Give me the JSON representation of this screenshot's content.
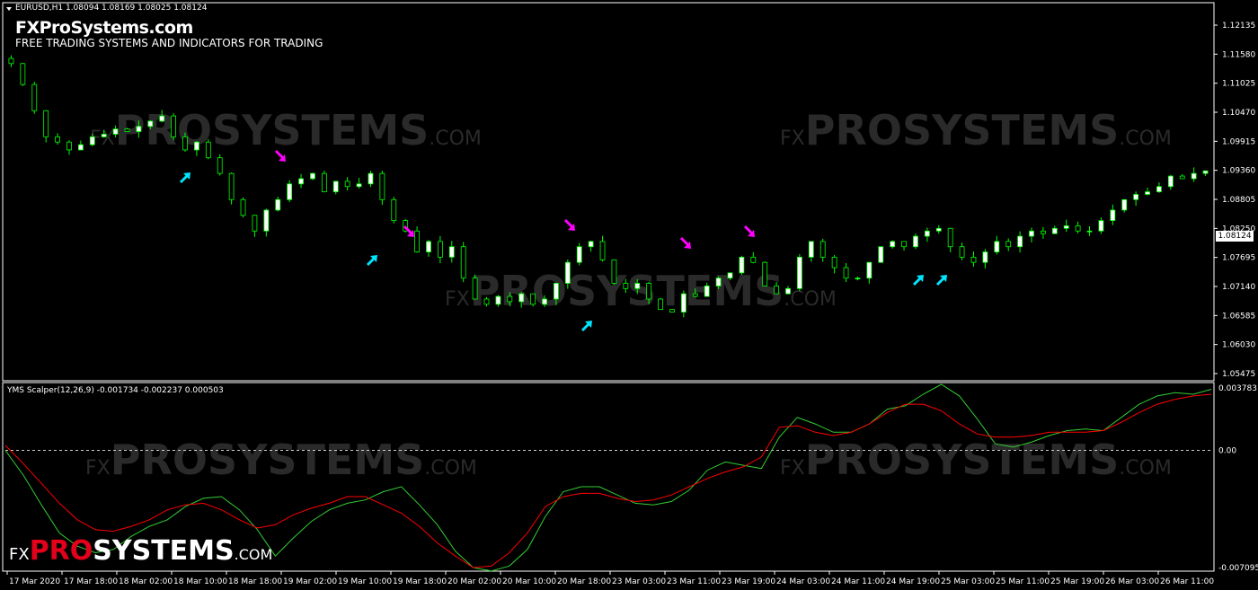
{
  "chart": {
    "symbol_line": "EURUSD,H1  1.08094 1.08169 1.08025 1.08124",
    "brand": "FXProSystems.com",
    "tagline": "FREE TRADING SYSTEMS AND INDICATORS FOR TRADING",
    "indicator_line": "YMS Scalper(12,26,9) -0.001734 -0.002237 0.000503",
    "current_price_label": "1.08124",
    "watermark": {
      "prefix": "FX",
      "main": "PROSYSTEMS",
      "suffix": ".COM"
    },
    "logo": {
      "fx": "FX",
      "pro": "PRO",
      "sys": "SYSTEMS",
      "com": ".COM"
    }
  },
  "chart_data": [
    {
      "type": "candlestick",
      "title": "EURUSD,H1",
      "y_ticks": [
        "1.12135",
        "1.11580",
        "1.11025",
        "1.10470",
        "1.09915",
        "1.09360",
        "1.08805",
        "1.08250",
        "1.07695",
        "1.07140",
        "1.06585",
        "1.06030",
        "1.05475"
      ],
      "ylim": [
        1.05475,
        1.12135
      ],
      "x_ticks": [
        "17 Mar 2020",
        "17 Mar 18:00",
        "18 Mar 02:00",
        "18 Mar 10:00",
        "18 Mar 18:00",
        "19 Mar 02:00",
        "19 Mar 10:00",
        "19 Mar 18:00",
        "20 Mar 02:00",
        "20 Mar 10:00",
        "20 Mar 18:00",
        "23 Mar 03:00",
        "23 Mar 11:00",
        "23 Mar 19:00",
        "24 Mar 03:00",
        "24 Mar 11:00",
        "24 Mar 19:00",
        "25 Mar 03:00",
        "25 Mar 11:00",
        "25 Mar 19:00",
        "26 Mar 03:00",
        "26 Mar 11:00"
      ],
      "close_path": [
        1.114,
        1.11,
        1.105,
        1.1,
        1.099,
        1.0975,
        1.0985,
        1.1,
        1.1005,
        1.1015,
        1.101,
        1.102,
        1.103,
        1.104,
        1.1,
        1.0975,
        1.099,
        1.096,
        1.093,
        1.088,
        1.085,
        1.082,
        1.086,
        1.088,
        1.091,
        1.092,
        1.093,
        1.0895,
        1.0915,
        1.0905,
        1.091,
        1.093,
        1.088,
        1.084,
        1.082,
        1.078,
        1.08,
        1.077,
        1.079,
        1.073,
        1.069,
        1.068,
        1.0695,
        1.0685,
        1.07,
        1.068,
        1.069,
        1.072,
        1.076,
        1.079,
        1.08,
        1.0765,
        1.072,
        1.071,
        1.072,
        1.069,
        1.067,
        1.0665,
        1.07,
        1.0695,
        1.0715,
        1.073,
        1.074,
        1.077,
        1.076,
        1.0715,
        1.07,
        1.071,
        1.077,
        1.08,
        1.077,
        1.075,
        1.073,
        1.073,
        1.076,
        1.079,
        1.08,
        1.079,
        1.081,
        1.082,
        1.0825,
        1.079,
        1.077,
        1.076,
        1.078,
        1.08,
        1.079,
        1.081,
        1.082,
        1.0815,
        1.0825,
        1.083,
        1.082,
        1.082,
        1.084,
        1.086,
        1.088,
        1.089,
        1.0895,
        1.0905,
        1.0925,
        1.092,
        1.093,
        1.0935
      ],
      "annotations": [
        {
          "kind": "buy-arrow",
          "color": "#00e5ff",
          "near": "18 Mar 10:00"
        },
        {
          "kind": "sell-arrow",
          "color": "#ff00ff",
          "near": "19 Mar 02:00"
        },
        {
          "kind": "buy-arrow",
          "color": "#00e5ff",
          "near": "19 Mar 10:00"
        },
        {
          "kind": "sell-arrow",
          "color": "#ff00ff",
          "near": "20 Mar 02:00"
        },
        {
          "kind": "buy-arrow",
          "color": "#00e5ff",
          "near": "20 Mar 18:00"
        },
        {
          "kind": "sell-arrow",
          "color": "#ff00ff",
          "near": "23 Mar 03:00"
        },
        {
          "kind": "sell-arrow",
          "color": "#ff00ff",
          "near": "23 Mar 11:00"
        },
        {
          "kind": "sell-arrow",
          "color": "#ff00ff",
          "near": "24 Mar 03:00"
        },
        {
          "kind": "buy-arrow",
          "color": "#00e5ff",
          "near": "25 Mar 03:00"
        },
        {
          "kind": "buy-arrow",
          "color": "#00e5ff",
          "near": "25 Mar 03:00"
        }
      ],
      "colors": {
        "bull": "#ffffff",
        "bear": "#000000",
        "wick": "#00ff00",
        "background": "#000000"
      }
    },
    {
      "type": "line",
      "title": "YMS Scalper(12,26,9)",
      "y_ticks": [
        "0.003783",
        "0.00",
        "-0.007095"
      ],
      "ylim": [
        -0.007095,
        0.003783
      ],
      "series": [
        {
          "name": "green",
          "color": "#32cd32",
          "values": [
            -0.0,
            -0.0015,
            -0.0033,
            -0.005,
            -0.0058,
            -0.0062,
            -0.006,
            -0.0052,
            -0.0046,
            -0.0042,
            -0.0034,
            -0.0029,
            -0.0028,
            -0.0036,
            -0.0048,
            -0.0064,
            -0.0053,
            -0.0043,
            -0.0036,
            -0.0032,
            -0.003,
            -0.0025,
            -0.0022,
            -0.0033,
            -0.0045,
            -0.0061,
            -0.0071,
            -0.0073,
            -0.007,
            -0.006,
            -0.004,
            -0.0025,
            -0.0022,
            -0.0022,
            -0.0027,
            -0.0032,
            -0.0033,
            -0.0031,
            -0.0024,
            -0.0012,
            -0.0007,
            -0.0009,
            -0.0011,
            0.0008,
            0.002,
            0.0016,
            0.0011,
            0.0011,
            0.0016,
            0.0025,
            0.0027,
            0.0034,
            0.004,
            0.0033,
            0.0019,
            0.0004,
            0.0002,
            0.0005,
            0.0009,
            0.0012,
            0.0013,
            0.0012,
            0.002,
            0.0028,
            0.0033,
            0.0035,
            0.0034,
            0.0037
          ]
        },
        {
          "name": "red",
          "color": "#ff0000",
          "values": [
            0.0003,
            -0.0008,
            -0.002,
            -0.0032,
            -0.0042,
            -0.0048,
            -0.0049,
            -0.0046,
            -0.0042,
            -0.0036,
            -0.0033,
            -0.0032,
            -0.0036,
            -0.0042,
            -0.0047,
            -0.0045,
            -0.0039,
            -0.0035,
            -0.0032,
            -0.0028,
            -0.0028,
            -0.0033,
            -0.0038,
            -0.0046,
            -0.0056,
            -0.0064,
            -0.0071,
            -0.007,
            -0.0062,
            -0.005,
            -0.0034,
            -0.0028,
            -0.0026,
            -0.0026,
            -0.0029,
            -0.0031,
            -0.003,
            -0.0027,
            -0.0022,
            -0.0017,
            -0.0013,
            -0.001,
            -0.0004,
            0.0014,
            0.0015,
            0.0011,
            0.0009,
            0.0011,
            0.0016,
            0.0023,
            0.0028,
            0.0028,
            0.0024,
            0.0016,
            0.001,
            0.0008,
            0.0008,
            0.0009,
            0.0011,
            0.0011,
            0.0011,
            0.0012,
            0.0017,
            0.0023,
            0.0028,
            0.0031,
            0.0033,
            0.0034
          ]
        }
      ],
      "reference_line": 0.0
    }
  ]
}
